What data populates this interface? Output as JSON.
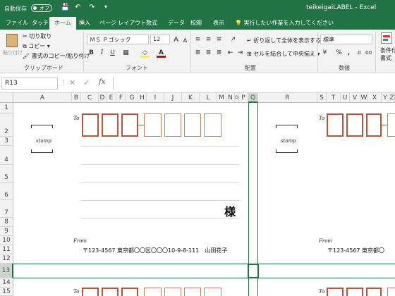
{
  "titlebar": {
    "autosave_label": "自動保存",
    "autosave_state": "オフ",
    "filename": "teikeigaiLABEL",
    "app": "Excel",
    "color": "#217346"
  },
  "tabs": [
    "ファイル",
    "タッチ",
    "ホーム",
    "挿入",
    "ページ レイアウト",
    "数式",
    "データ",
    "校閲",
    "表示"
  ],
  "tell_me": "実行したい作業を入力してください",
  "ribbon": {
    "clipboard": {
      "paste": "貼り付け",
      "cut": "切り取り",
      "copy": "コピー",
      "format_painter": "書式のコピー/貼り付け",
      "label": "クリップボード"
    },
    "font": {
      "name": "ＭＳ Ｐゴシック",
      "size": "12",
      "grow": "A",
      "shrink": "A",
      "bold": "B",
      "italic": "I",
      "underline": "U",
      "label": "フォント"
    },
    "alignment": {
      "wrap": "折り返して全体を表示する",
      "merge": "セルを結合して中央揃え",
      "label": "配置"
    },
    "number": {
      "format": "標準",
      "percent": "%",
      "comma": ",",
      "label": "数値"
    },
    "styles": {
      "conditional": "条件付き",
      "conditional2": "書式"
    }
  },
  "formula_bar": {
    "cell_ref": "R13",
    "fx": "fx",
    "value": ""
  },
  "columns": [
    "A",
    "B",
    "C",
    "D",
    "E",
    "F",
    "G",
    "H",
    "I",
    "J",
    "K",
    "L",
    "M",
    "N",
    "O",
    "P",
    "Q",
    "R",
    "S",
    "T",
    "U",
    "V",
    "W",
    "X",
    "Y",
    "Z",
    "A"
  ],
  "rows": [
    "1",
    "2",
    "3",
    "4",
    "5",
    "6",
    "7",
    "8",
    "9",
    "10",
    "11",
    "12",
    "13",
    "14",
    "15"
  ],
  "sheet": {
    "to_label": "To",
    "to_label_right": "To",
    "to_label_bottom": "To",
    "to_label_bottom_right": "To",
    "stamp_label": "stamp",
    "stamp_label_right": "stamp",
    "sama": "様",
    "from_label": "From",
    "from_label_right": "From",
    "sender_address": "〒123-4567 東京都〇〇区〇〇〇10-9-8-111　山田花子",
    "sender_address_right": "〒123-4567 東京都〇"
  },
  "colors": {
    "postal_box_border": "#b5533c",
    "selection": "#217346"
  }
}
